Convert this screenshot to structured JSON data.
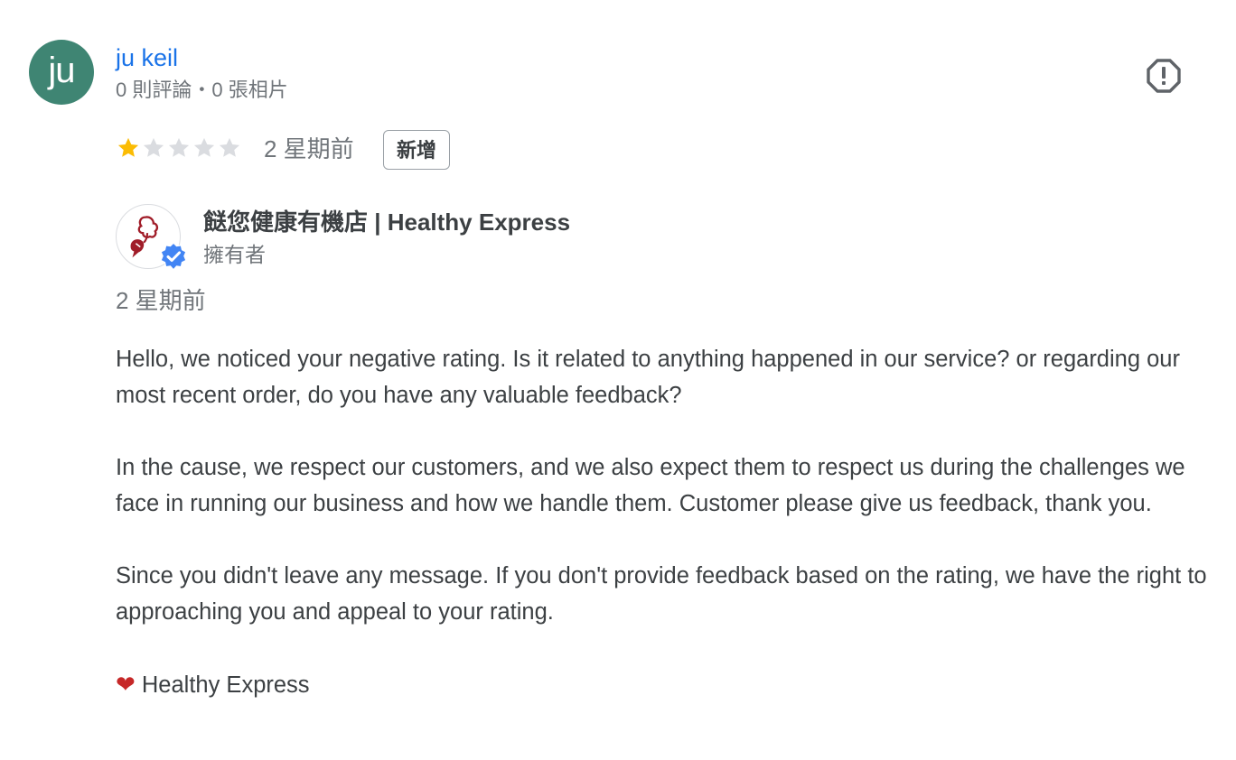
{
  "reviewer": {
    "avatar_initials": "ju",
    "avatar_color": "#3f8573",
    "name": "ju keil",
    "meta": "0 則評論・0 張相片"
  },
  "review": {
    "rating": 1,
    "max_rating": 5,
    "time": "2 星期前",
    "badge": "新增"
  },
  "owner_reply": {
    "owner_name": "餸您健康有機店 | Healthy Express",
    "role": "擁有者",
    "time": "2 星期前",
    "paragraphs": [
      "Hello, we noticed your negative rating. Is it related to anything happened in our service? or regarding our most recent order, do you have any valuable feedback?",
      "In the cause, we respect our customers, and we also expect them to respect us during the challenges we face in running our business and how we handle them. Customer please give us feedback, thank you.",
      "Since you didn't leave any message. If you don't provide feedback based on the rating, we have the right to approaching you and appeal to your rating."
    ],
    "signature_icon": "heart-icon",
    "signature": "Healthy Express"
  },
  "colors": {
    "link_blue": "#1a73e8",
    "star_filled": "#fbbc04",
    "star_empty": "#dadce0",
    "verified_blue": "#4285f4",
    "logo_red": "#a01c28"
  },
  "icons": {
    "report": "report-flag-icon",
    "verified": "verified-check-icon",
    "star": "star-icon"
  }
}
